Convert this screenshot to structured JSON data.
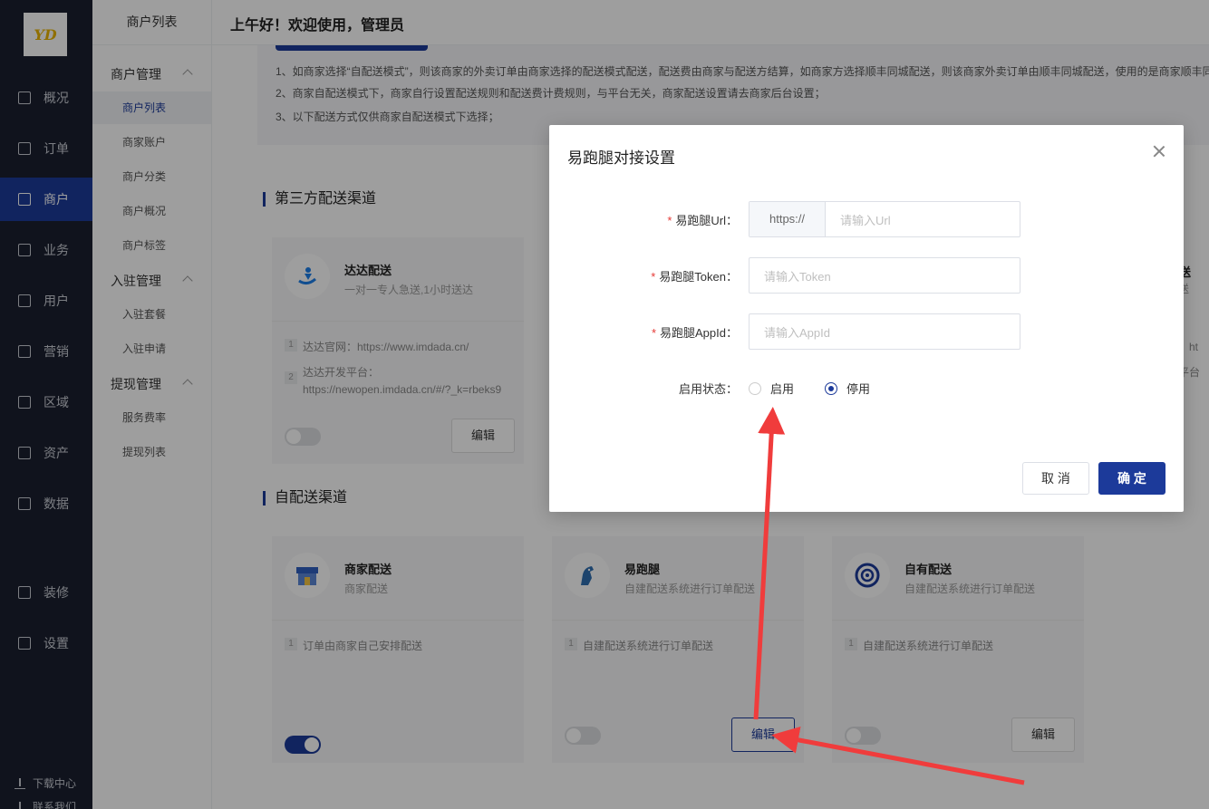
{
  "logo_text": "YD",
  "nav": {
    "items": [
      {
        "label": "概况",
        "icon": "monitor-icon"
      },
      {
        "label": "订单",
        "icon": "order-icon"
      },
      {
        "label": "商户",
        "icon": "store-icon",
        "active": true
      },
      {
        "label": "业务",
        "icon": "business-icon"
      },
      {
        "label": "用户",
        "icon": "user-icon"
      },
      {
        "label": "营销",
        "icon": "marketing-icon"
      },
      {
        "label": "区域",
        "icon": "region-icon"
      },
      {
        "label": "资产",
        "icon": "asset-icon"
      },
      {
        "label": "数据",
        "icon": "chart-icon"
      },
      {
        "label": "装修",
        "icon": "decorate-icon"
      },
      {
        "label": "设置",
        "icon": "settings-icon"
      }
    ],
    "footer": {
      "download": "下载中心",
      "contact": "联系我们"
    }
  },
  "submenu": {
    "title": "商户列表",
    "groups": [
      {
        "label": "商户管理",
        "items": [
          "商户列表",
          "商家账户",
          "商户分类",
          "商户概况",
          "商户标签"
        ]
      },
      {
        "label": "入驻管理",
        "items": [
          "入驻套餐",
          "入驻申请"
        ]
      },
      {
        "label": "提现管理",
        "items": [
          "服务费率",
          "提现列表"
        ]
      }
    ]
  },
  "header": {
    "greeting": "上午好！欢迎使用，管理员"
  },
  "notice": {
    "lines": [
      "1、如商家选择“自配送模式”，则该商家的外卖订单由商家选择的配送模式配送，配送费由商家与配送方结算，如商家方选择顺丰同城配送，则该商家外卖订单由顺丰同城配送，使用的是商家顺丰同",
      "2、商家自配送模式下，商家自行设置配送规则和配送费计费规则，与平台无关，商家配送设置请去商家后台设置；",
      "3、以下配送方式仅供商家自配送模式下选择；"
    ]
  },
  "sections": {
    "third_party": "第三方配送渠道",
    "self": "自配送渠道"
  },
  "third_party_cards": [
    {
      "title": "达达配送",
      "desc": "一对一专人急送,1小时送达",
      "lines": [
        "达达官网：https://www.imdada.cn/",
        "达达开发平台：",
        "https://newopen.imdada.cn/#/?_k=rbeks9"
      ],
      "edit": "编辑",
      "enabled": false
    }
  ],
  "right_partial": {
    "title": "闪送",
    "desc": "闪送",
    "line1": "网：ht",
    "line2": "发平台"
  },
  "self_cards": [
    {
      "title": "商家配送",
      "desc": "商家配送",
      "line": "订单由商家自己安排配送",
      "enabled": true,
      "edit": ""
    },
    {
      "title": "易跑腿",
      "desc": "自建配送系统进行订单配送",
      "line": "自建配送系统进行订单配送",
      "enabled": false,
      "edit": "编辑"
    },
    {
      "title": "自有配送",
      "desc": "自建配送系统进行订单配送",
      "line": "自建配送系统进行订单配送",
      "enabled": false,
      "edit": "编辑"
    }
  ],
  "modal": {
    "title": "易跑腿对接设置",
    "fields": {
      "url_label": "易跑腿Url：",
      "url_prefix": "https://",
      "url_placeholder": "请输入Url",
      "token_label": "易跑腿Token：",
      "token_placeholder": "请输入Token",
      "appid_label": "易跑腿AppId：",
      "appid_placeholder": "请输入AppId",
      "status_label": "启用状态：",
      "enable": "启用",
      "disable": "停用",
      "selected": "停用"
    },
    "cancel": "取 消",
    "confirm": "确 定"
  },
  "colors": {
    "brand": "#1c3a9a",
    "nav_bg": "#1b2030",
    "required": "#e53935",
    "annotation_arrow": "#f03c3c"
  }
}
